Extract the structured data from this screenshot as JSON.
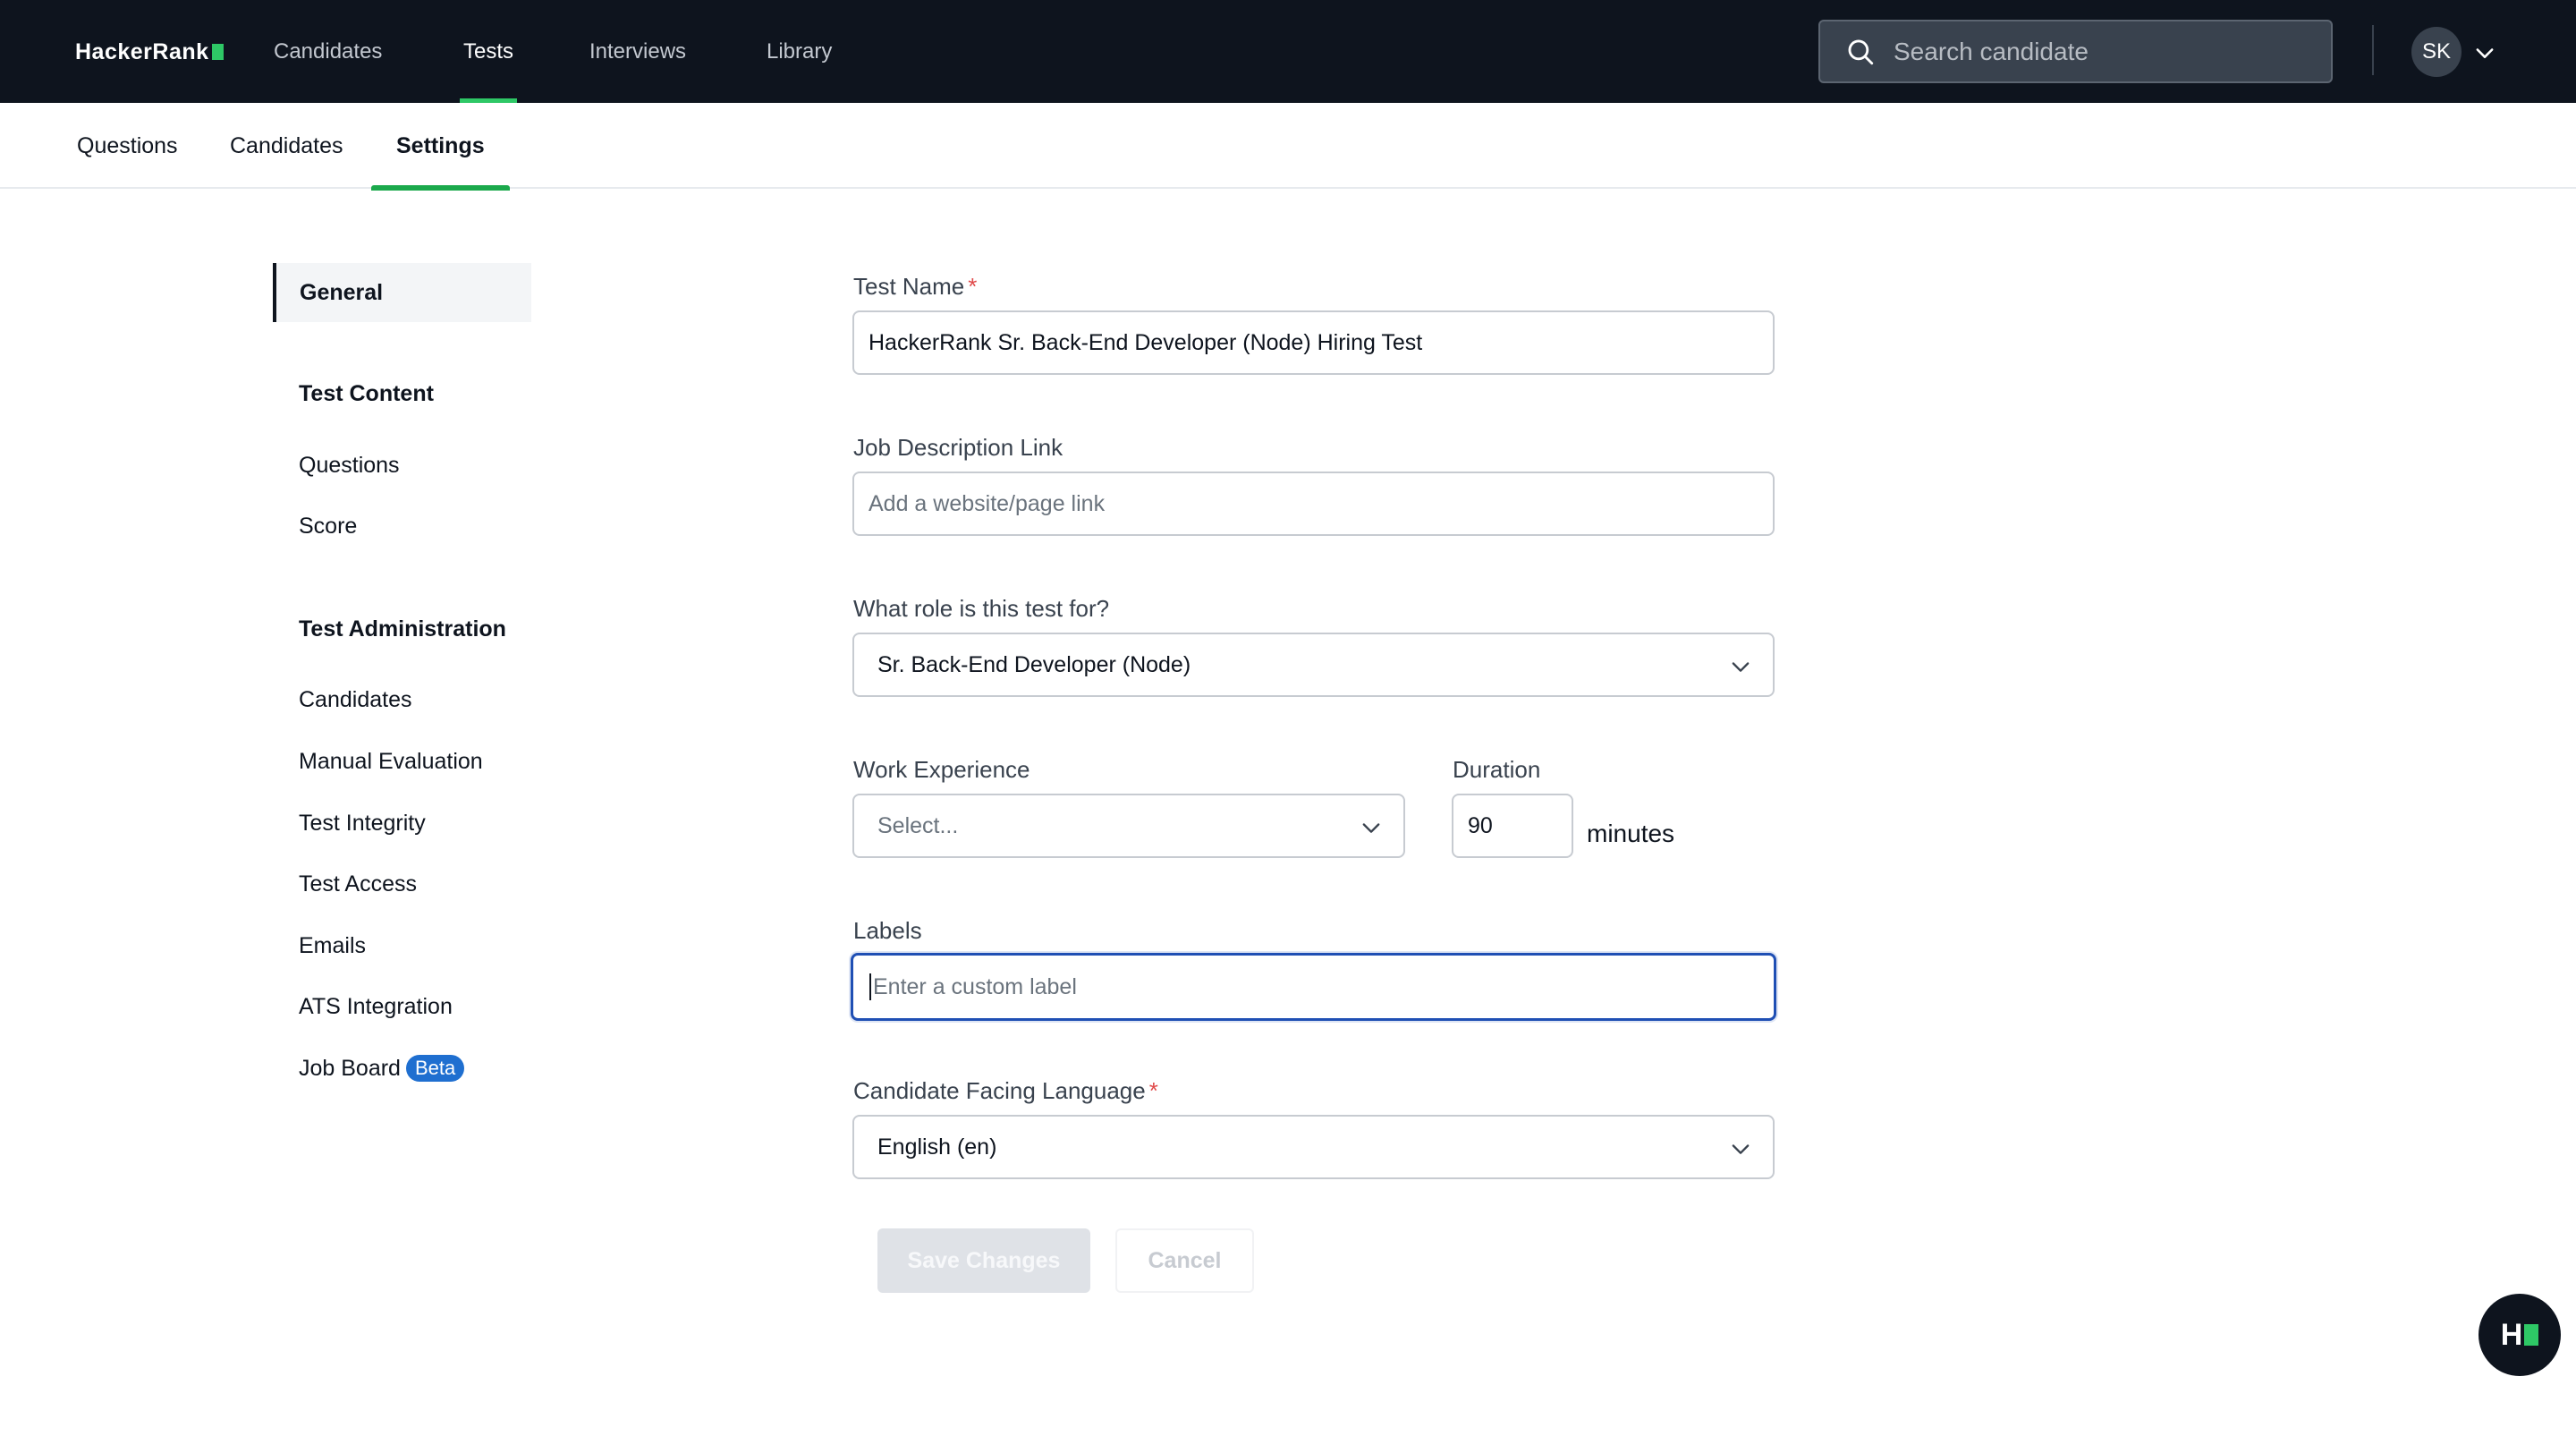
{
  "nav": {
    "logo": "HackerRank",
    "items": [
      "Candidates",
      "Tests",
      "Interviews",
      "Library"
    ],
    "active": "Tests",
    "search_placeholder": "Search candidate",
    "avatar_initials": "SK"
  },
  "subtabs": {
    "items": [
      "Questions",
      "Candidates",
      "Settings"
    ],
    "active": "Settings"
  },
  "settings_nav": {
    "general": "General",
    "test_content_heading": "Test Content",
    "test_content_items": [
      "Questions",
      "Score"
    ],
    "test_admin_heading": "Test Administration",
    "test_admin_items": [
      "Candidates",
      "Manual Evaluation",
      "Test Integrity",
      "Test Access",
      "Emails",
      "ATS Integration",
      "Job Board"
    ],
    "job_board_badge": "Beta"
  },
  "form": {
    "test_name_label": "Test Name",
    "required_mark": "*",
    "test_name_value": "HackerRank Sr. Back-End Developer (Node) Hiring Test",
    "job_desc_label": "Job Description Link",
    "job_desc_placeholder": "Add a website/page link",
    "role_label": "What role is this test for?",
    "role_value": "Sr. Back-End Developer (Node)",
    "work_exp_label": "Work Experience",
    "work_exp_placeholder": "Select...",
    "duration_label": "Duration",
    "duration_value": "90",
    "duration_unit": "minutes",
    "labels_label": "Labels",
    "labels_placeholder": "Enter a custom label",
    "language_label": "Candidate Facing Language",
    "language_value": "English (en)",
    "save_button": "Save Changes",
    "cancel_button": "Cancel"
  },
  "colors": {
    "navbar_bg": "#0e141e",
    "brand_green": "#2ec866",
    "focus_blue": "#1f4fb4",
    "beta_badge": "#1f6fd0"
  },
  "icons": {
    "search": "search-icon",
    "chevron": "chevron-down-icon",
    "help": "help-chat-icon"
  }
}
